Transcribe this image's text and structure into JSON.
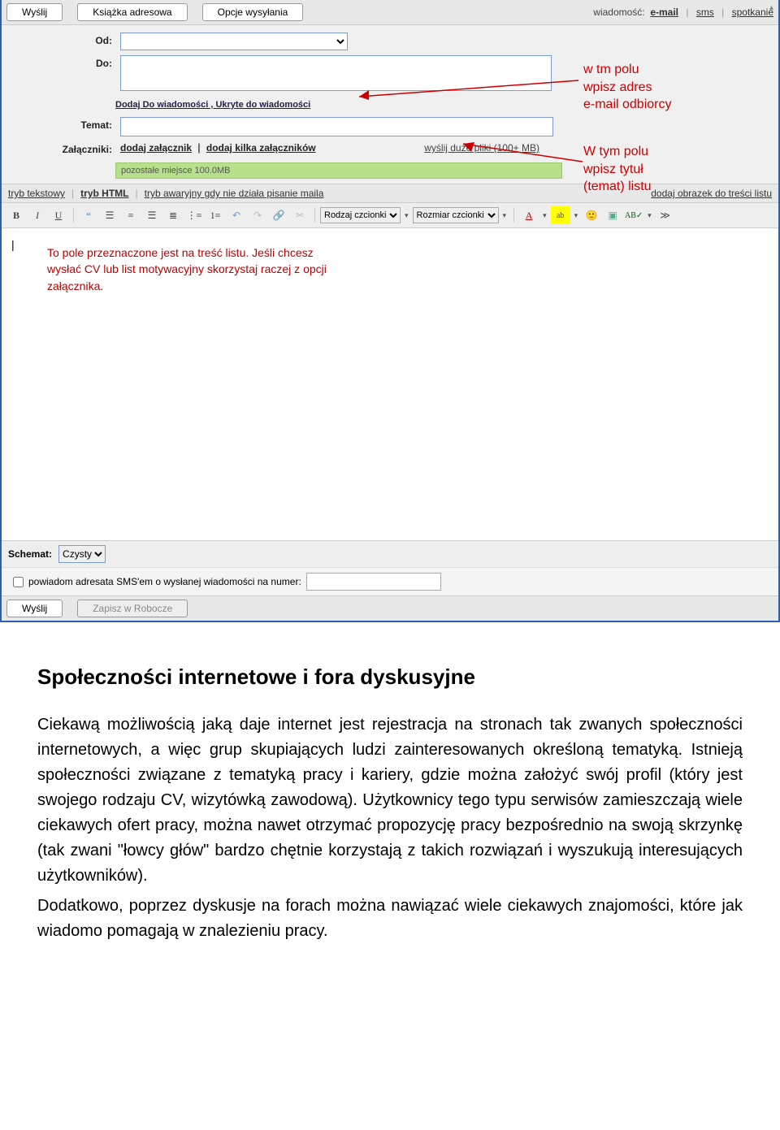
{
  "toolbar": {
    "send": "Wyślij",
    "addressbook": "Książka adresowa",
    "send_options": "Opcje wysyłania",
    "message_label": "wiadomość:",
    "email": "e-mail",
    "sms": "sms",
    "meeting": "spotkanie"
  },
  "labels": {
    "from": "Od:",
    "to": "Do:",
    "subject": "Temat:",
    "attachments": "Załączniki:",
    "schemat": "Schemat:"
  },
  "links": {
    "add_cc_bcc": "Dodaj Do wiadomości , Ukryte do wiadomości",
    "add_attachment": "dodaj załącznik",
    "add_many_attachments": "dodaj kilka załączników",
    "send_big_files": "wyślij duże pliki (100+ MB)",
    "mode_text": "tryb tekstowy",
    "mode_html": "tryb HTML",
    "mode_emergency": "tryb awaryjny gdy nie działa pisanie maila",
    "add_image_to_body": "dodaj obrazek do treści listu"
  },
  "storage_text": "pozostałe miejsce 100.0MB",
  "editor_toolbar": {
    "font_family_label": "Rodzaj czcionki",
    "font_size_label": "Rozmiar czcionki"
  },
  "editor_hint": "To pole przeznaczone jest na treść listu. Jeśli chcesz wysłać CV lub list motywacyjny skorzystaj raczej z opcji załącznika.",
  "schemat_value": "Czysty",
  "sms_row": {
    "text": "powiadom adresata SMS'em o wysłanej wiadomości na numer:"
  },
  "bottom": {
    "send": "Wyślij",
    "save_draft": "Zapisz w Robocze"
  },
  "annotations": {
    "to_field": "w tm polu\nwpisz adres\ne-mail odbiorcy",
    "subject_field": "W tym polu\nwpisz tytuł\n(temat) listu"
  },
  "article": {
    "heading": "Społeczności internetowe i fora dyskusyjne",
    "p1": "Ciekawą możliwością jaką daje internet jest rejestracja na stronach tak zwanych społeczności internetowych, a więc grup skupiających ludzi zainteresowanych określoną tematyką. Istnieją społeczności związane z tematyką pracy i kariery, gdzie można założyć swój profil (który jest swojego rodzaju CV, wizytówką zawodową). Użytkownicy tego typu serwisów zamieszczają wiele ciekawych ofert pracy, można nawet otrzymać propozycję pracy bezpośrednio na swoją skrzynkę (tak zwani \"łowcy głów\" bardzo chętnie korzystają z takich rozwiązań i wyszukują interesujących użytkowników).",
    "p2": "Dodatkowo, poprzez dyskusje na forach można nawiązać wiele ciekawych znajomości, które jak wiadomo pomagają w znalezieniu pracy."
  }
}
